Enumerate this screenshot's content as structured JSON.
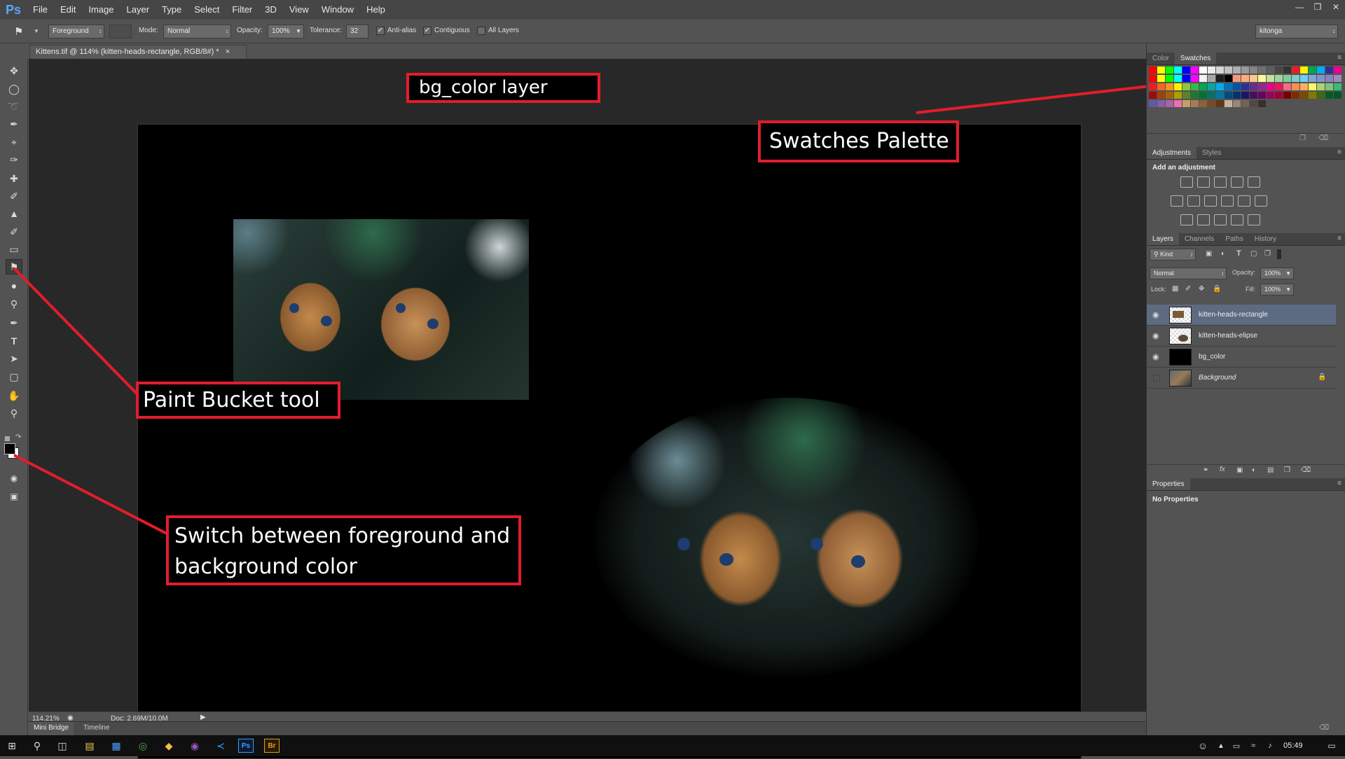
{
  "app": {
    "logo": "Ps"
  },
  "menu": [
    "File",
    "Edit",
    "Image",
    "Layer",
    "Type",
    "Select",
    "Filter",
    "3D",
    "View",
    "Window",
    "Help"
  ],
  "options_bar": {
    "fill_source": "Foreground",
    "mode_label": "Mode:",
    "mode_value": "Normal",
    "opacity_label": "Opacity:",
    "opacity_value": "100%",
    "tolerance_label": "Tolerance:",
    "tolerance_value": "32",
    "anti_alias_label": "Anti-alias",
    "anti_alias_checked": true,
    "contiguous_label": "Contiguous",
    "contiguous_checked": true,
    "all_layers_label": "All Layers",
    "all_layers_checked": false,
    "workspace": "kitonga"
  },
  "document": {
    "tab_title": "Kittens.tif @ 114% (kitten-heads-rectangle, RGB/8#) *",
    "close_glyph": "×"
  },
  "annotations": {
    "bg_color_layer": "bg_color layer",
    "swatches_palette": "Swatches Palette",
    "paint_bucket": "Paint Bucket tool",
    "switch_line1": "Switch between foreground and",
    "switch_line2": "background color"
  },
  "annotation_color": "#e21d2b",
  "status": {
    "zoom": "114.21%",
    "doc": "Doc: 2.69M/10.0M"
  },
  "bottom_tabs": [
    "Mini Bridge",
    "Timeline"
  ],
  "swatches_panel": {
    "tabs": [
      "Color",
      "Swatches"
    ],
    "active": "Swatches"
  },
  "adjustments_panel": {
    "tabs": [
      "Adjustments",
      "Styles"
    ],
    "active": "Adjustments",
    "heading": "Add an adjustment"
  },
  "layers_panel": {
    "tabs": [
      "Layers",
      "Channels",
      "Paths",
      "History"
    ],
    "active": "Layers",
    "filter": "Kind",
    "blend_mode": "Normal",
    "opacity_label": "Opacity:",
    "opacity_value": "100%",
    "lock_label": "Lock:",
    "fill_label": "Fill:",
    "fill_value": "100%",
    "layers": [
      {
        "name": "kitten-heads-rectangle",
        "visible": true,
        "selected": true
      },
      {
        "name": "kitten-heads-elipse",
        "visible": true,
        "selected": false
      },
      {
        "name": "bg_color",
        "visible": true,
        "selected": false
      },
      {
        "name": "Background",
        "visible": false,
        "selected": false,
        "locked": true
      }
    ]
  },
  "properties_panel": {
    "title": "Properties",
    "body": "No Properties"
  },
  "taskbar": {
    "time": "05:49"
  }
}
